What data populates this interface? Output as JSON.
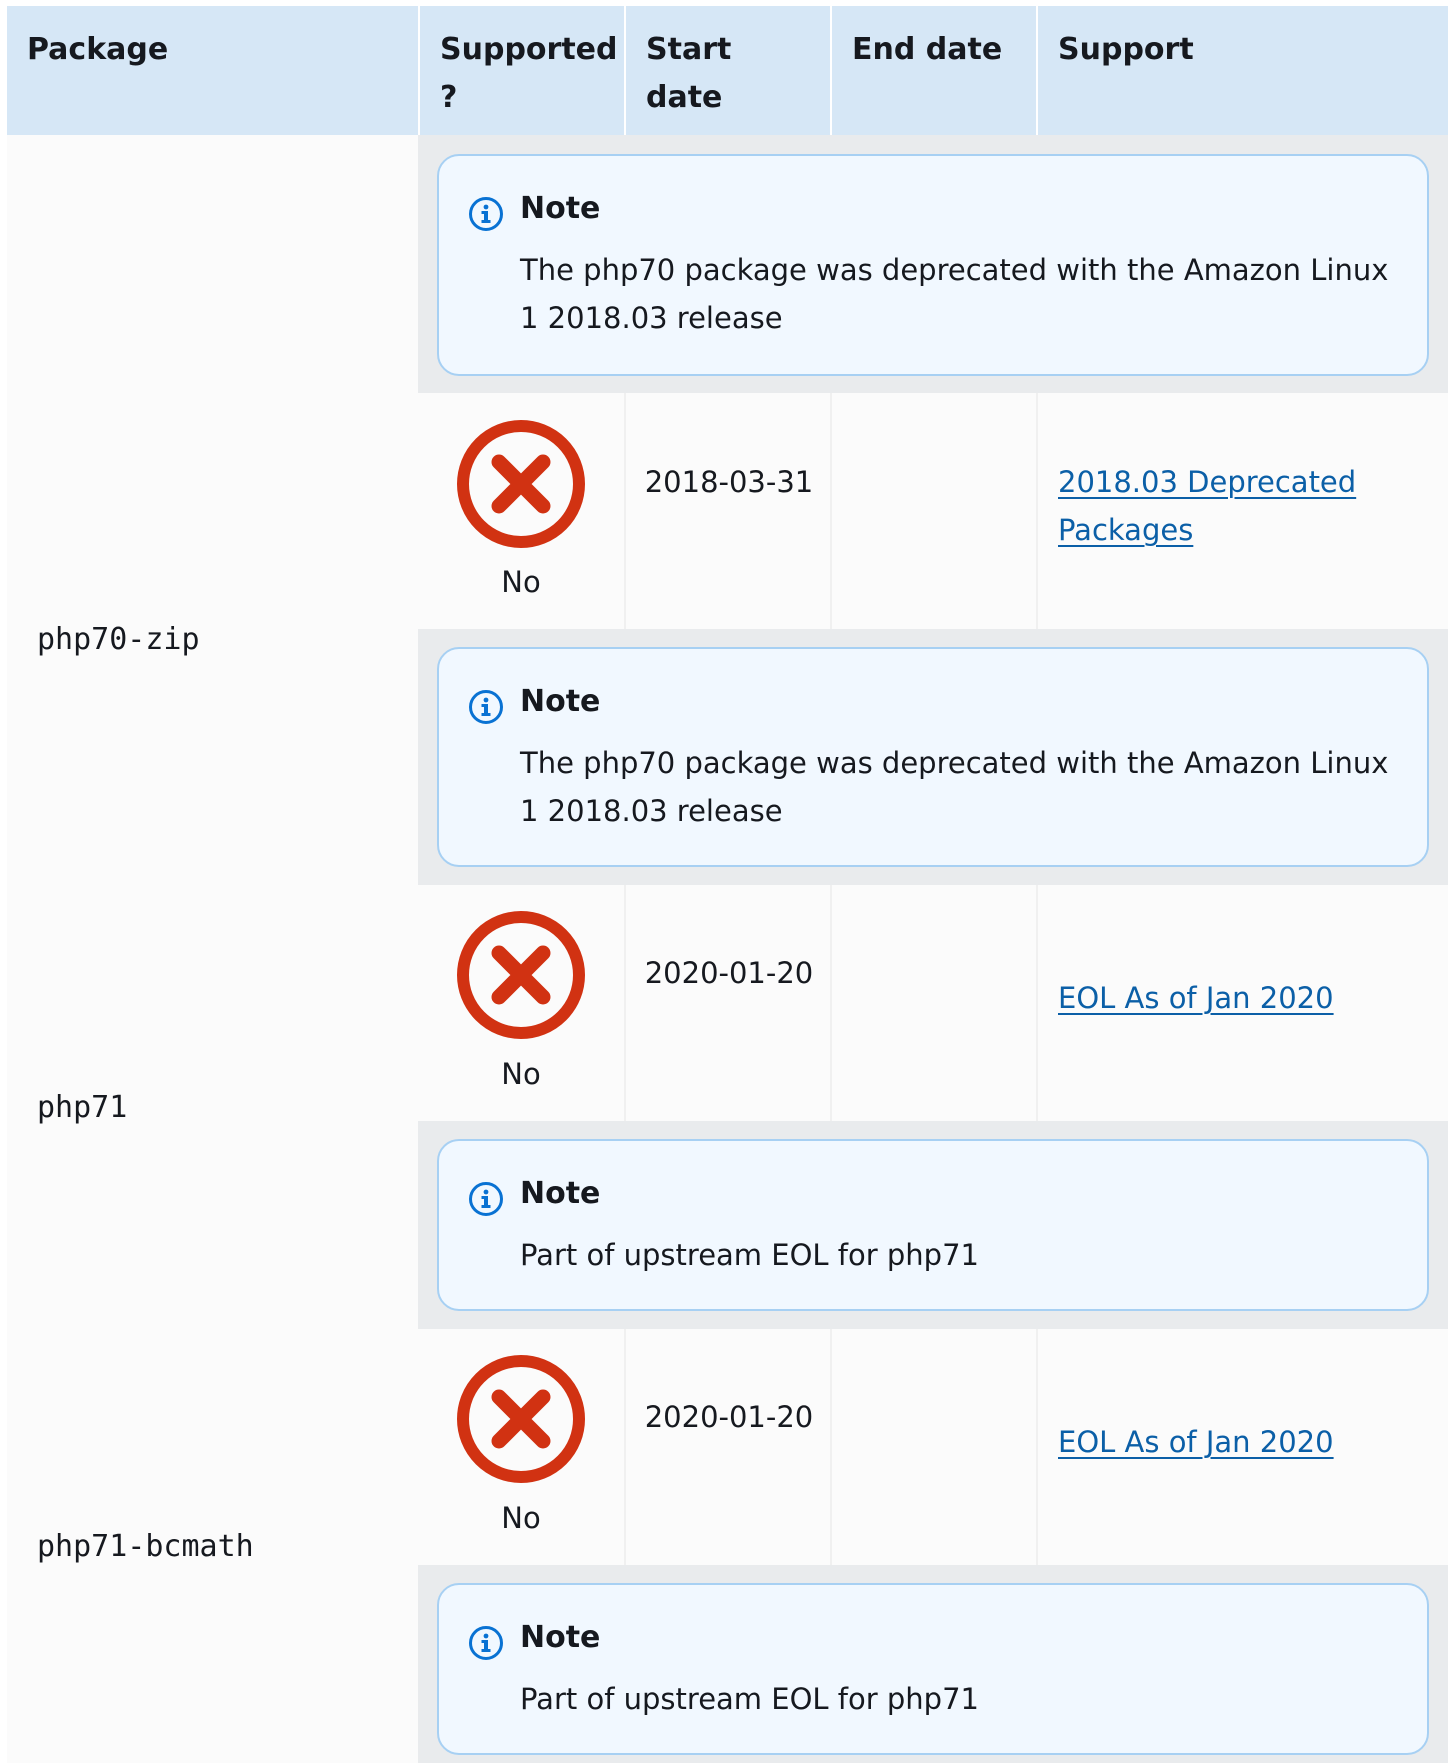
{
  "header": {
    "package": "Package",
    "supported": "Supported ?",
    "start_date": "Start date",
    "end_date": "End date",
    "support": "Support"
  },
  "notes": [
    {
      "title": "Note",
      "text": "The php70 package was deprecated with the Amazon Linux 1 2018.03 release"
    },
    {
      "title": "Note",
      "text": "The php70 package was deprecated with the Amazon Linux 1 2018.03 release"
    },
    {
      "title": "Note",
      "text": "Part of upstream EOL for php71"
    },
    {
      "title": "Note",
      "text": "Part of upstream EOL for php71"
    }
  ],
  "rows": [
    {
      "package": "php70-zip",
      "supported": "No",
      "start_date": "2018-03-31",
      "end_date": "",
      "support_link": "2018.03 Deprecated Packages"
    },
    {
      "package": "php71",
      "supported": "No",
      "start_date": "2020-01-20",
      "end_date": "",
      "support_link": "EOL As of Jan 2020"
    },
    {
      "package": "php71-bcmath",
      "supported": "No",
      "start_date": "2020-01-20",
      "end_date": "",
      "support_link": "EOL As of Jan 2020"
    }
  ],
  "colors": {
    "header_bg": "#d6e7f6",
    "note_bg": "#f1f8ff",
    "note_border": "#a7d0f3",
    "link": "#0b5fa7",
    "status_no": "#d13212"
  },
  "icons": {
    "status_no": "x-circle-icon",
    "note": "info-icon"
  }
}
